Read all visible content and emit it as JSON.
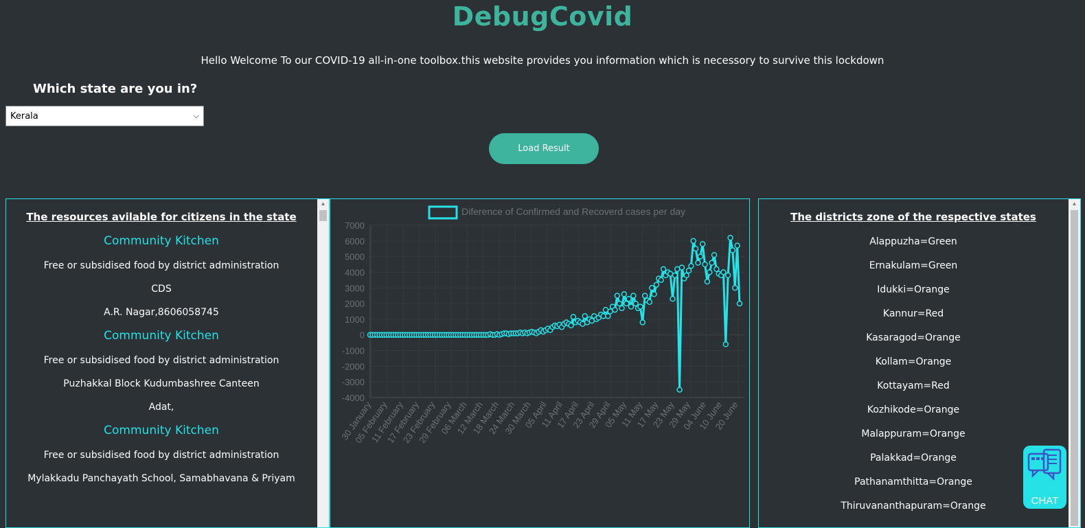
{
  "brand": "DebugCovid",
  "welcome_text": "Hello Welcome To our COVID-19 all-in-one toolbox.this website provides you information which is necessory to survive this lockdown",
  "state_question": "Which state are you in?",
  "state_select": {
    "selected": "Kerala"
  },
  "load_button": "Load Result",
  "resources_panel": {
    "title": "The resources avilable for citizens in the state",
    "items": [
      {
        "title": "Community Kitchen",
        "lines": [
          "Free or subsidised food by district administration",
          "CDS",
          "A.R. Nagar,8606058745"
        ]
      },
      {
        "title": "Community Kitchen",
        "lines": [
          "Free or subsidised food by district administration",
          "Puzhakkal Block Kudumbashree Canteen",
          "Adat,"
        ]
      },
      {
        "title": "Community Kitchen",
        "lines": [
          "Free or subsidised food by district administration",
          "Mylakkadu Panchayath School, Samabhavana & Priyam"
        ]
      }
    ]
  },
  "districts_panel": {
    "title": "The districts zone of the respective states",
    "items": [
      "Alappuzha=Green",
      "Ernakulam=Green",
      "Idukki=Orange",
      "Kannur=Red",
      "Kasaragod=Orange",
      "Kollam=Orange",
      "Kottayam=Red",
      "Kozhikode=Orange",
      "Malappuram=Orange",
      "Palakkad=Orange",
      "Pathanamthitta=Orange",
      "Thiruvananthapuram=Orange"
    ]
  },
  "chat_button": {
    "label": "CHAT",
    "icon": "chat-icon"
  },
  "colors": {
    "brand": "#3eb39e",
    "accent": "#26e1e6",
    "background": "#2b3135"
  },
  "chart_data": {
    "type": "line",
    "legend": "Diference of Confirmed and Recoverd cases per day",
    "legend_position": "top",
    "ylim": [
      -4000,
      7000
    ],
    "yticks": [
      7000,
      6000,
      5000,
      4000,
      3000,
      2000,
      1000,
      0,
      -1000,
      -2000,
      -3000,
      -4000
    ],
    "xticks": [
      "30 January",
      "05 February",
      "11 February",
      "17 February",
      "23 February",
      "29 February",
      "06 March",
      "12 March",
      "18 March",
      "24 March",
      "30 March",
      "05 April",
      "11 April",
      "17 April",
      "23 April",
      "29 April",
      "05 May",
      "11 May",
      "17 May",
      "23 May",
      "29 May",
      "04 June",
      "10 June",
      "20 June"
    ],
    "grid": true,
    "series": [
      {
        "values": [
          0,
          0,
          0,
          0,
          0,
          0,
          0,
          0,
          0,
          0,
          0,
          0,
          0,
          0,
          0,
          0,
          0,
          0,
          0,
          0,
          0,
          0,
          0,
          0,
          0,
          0,
          0,
          0,
          0,
          0,
          0,
          0,
          0,
          0,
          0,
          0,
          0,
          0,
          0,
          0,
          0,
          0,
          0,
          0,
          0,
          0,
          0,
          0,
          0,
          0,
          0,
          0,
          50,
          0,
          0,
          50,
          0,
          50,
          100,
          100,
          50,
          100,
          100,
          100,
          100,
          150,
          100,
          150,
          100,
          150,
          200,
          150,
          100,
          200,
          300,
          200,
          300,
          400,
          300,
          500,
          600,
          550,
          650,
          500,
          700,
          800,
          700,
          600,
          1150,
          800,
          900,
          800,
          700,
          1200,
          800,
          1000,
          900,
          1200,
          1000,
          1100,
          1300,
          1200,
          1600,
          1200,
          1500,
          1800,
          1600,
          2500,
          2000,
          1700,
          2600,
          2000,
          2300,
          1800,
          2500,
          2000,
          1700,
          1800,
          800,
          2500,
          2200,
          2100,
          3000,
          2600,
          3200,
          3600,
          3500,
          4200,
          3800,
          4000,
          3900,
          2300,
          3800,
          4200,
          -3500,
          4300,
          3600,
          3800,
          4100,
          4400,
          6000,
          5500,
          4600,
          5000,
          5800,
          4500,
          3400,
          4000,
          4600,
          5100,
          4200,
          3900,
          3800,
          4000,
          -600,
          3800,
          6200,
          5400,
          3000,
          5700,
          2000
        ]
      }
    ]
  }
}
